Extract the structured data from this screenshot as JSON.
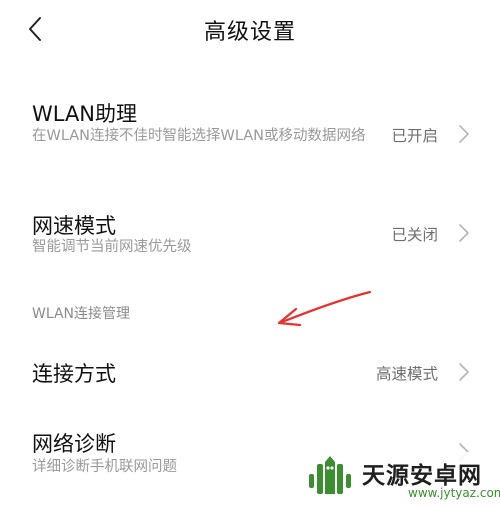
{
  "header": {
    "title": "高级设置",
    "back_icon": "chevron-left-icon"
  },
  "wlan_assistant": {
    "title": "WLAN助理",
    "desc": "在WLAN连接不佳时智能选择WLAN或移动数据网络",
    "value": "已开启"
  },
  "speed_mode": {
    "title": "网速模式",
    "desc": "智能调节当前网速优先级",
    "value": "已关闭"
  },
  "section": {
    "title": "WLAN连接管理"
  },
  "connection_method": {
    "title": "连接方式",
    "value": "高速模式"
  },
  "network_diagnosis": {
    "title": "网络诊断",
    "desc": "详细诊断手机联网问题"
  },
  "watermark": {
    "name": "天源安卓网",
    "url": "www.jytyaz.com"
  },
  "colors": {
    "annotation_arrow": "#e8322d",
    "watermark_green": "#3b8f2e"
  }
}
